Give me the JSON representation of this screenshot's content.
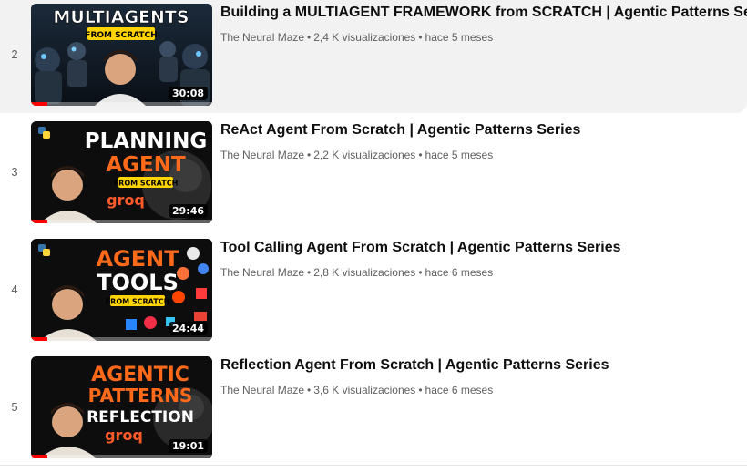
{
  "colors": {
    "accent_red": "#ff0000",
    "thumb_orange": "#ff6a1a",
    "thumb_yellow": "#ffd400",
    "title_text": "#0f0f0f",
    "meta_text": "#606060"
  },
  "playlist": {
    "items": [
      {
        "index": "2",
        "title": "Building a MULTIAGENT FRAMEWORK from SCRATCH | Agentic Patterns Series",
        "channel": "The Neural Maze",
        "views": "2,4 K visualizaciones",
        "age": "hace 5 meses",
        "duration": "30:08",
        "progress": 0.09,
        "thumb_line1": "MULTIAGENTS",
        "thumb_line2": "FROM SCRATCH"
      },
      {
        "index": "3",
        "title": "ReAct Agent From Scratch | Agentic Patterns Series",
        "channel": "The Neural Maze",
        "views": "2,2 K visualizaciones",
        "age": "hace 5 meses",
        "duration": "29:46",
        "progress": 0.09,
        "thumb_line1": "PLANNING",
        "thumb_line2": "AGENT",
        "thumb_line3": "FROM SCRATCH",
        "thumb_brand": "groq"
      },
      {
        "index": "4",
        "title": "Tool Calling Agent From Scratch | Agentic Patterns Series",
        "channel": "The Neural Maze",
        "views": "2,8 K visualizaciones",
        "age": "hace 6 meses",
        "duration": "24:44",
        "progress": 0.09,
        "thumb_line1": "AGENT",
        "thumb_line2": "TOOLS",
        "thumb_line3": "FROM SCRATCH"
      },
      {
        "index": "5",
        "title": "Reflection Agent From Scratch | Agentic Patterns Series",
        "channel": "The Neural Maze",
        "views": "3,6 K visualizaciones",
        "age": "hace 6 meses",
        "duration": "19:01",
        "progress": 0.09,
        "thumb_line1": "AGENTIC",
        "thumb_line2": "PATTERNS",
        "thumb_line3": "REFLECTION",
        "thumb_brand": "groq"
      }
    ],
    "separator": "•"
  }
}
